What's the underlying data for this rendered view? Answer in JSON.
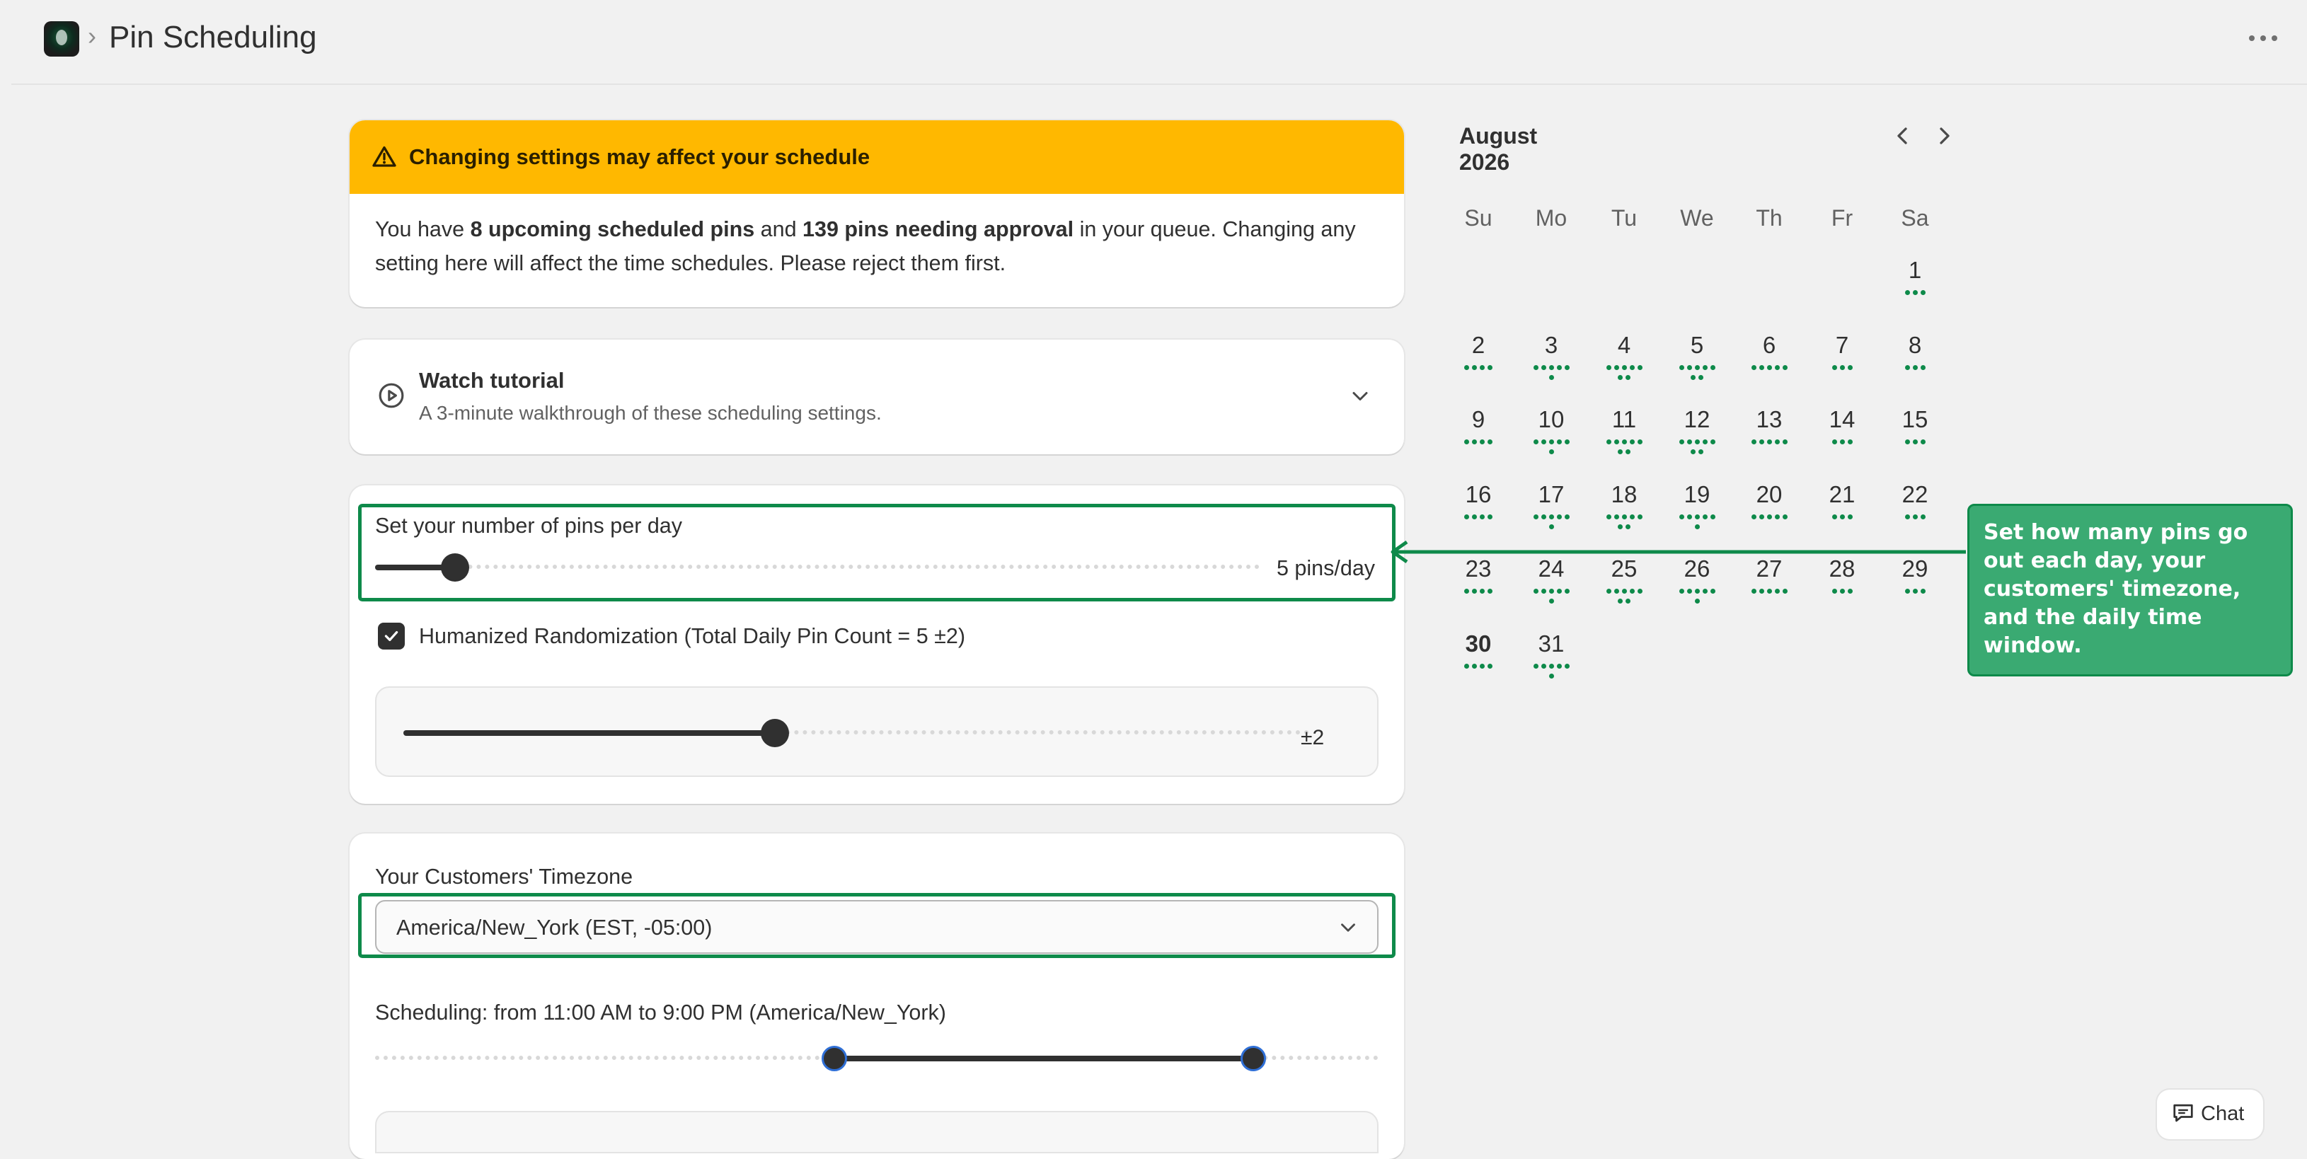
{
  "header": {
    "breadcrumb_separator": "›",
    "title": "Pin Scheduling",
    "more_icon": "more-horizontal-icon"
  },
  "banner": {
    "icon": "warning-triangle-icon",
    "title": "Changing settings may affect your schedule",
    "body_prefix": "You have ",
    "scheduled_count": "8 upcoming scheduled pins",
    "body_mid": " and ",
    "approval_count": "139 pins needing approval",
    "body_suffix": " in your queue. Changing any setting here will affect the time schedules. Please reject them first.",
    "color": "#ffb800"
  },
  "tutorial": {
    "icon": "play-circle-icon",
    "title": "Watch tutorial",
    "subtitle": "A 3-minute walkthrough of these scheduling settings.",
    "expanded": false
  },
  "pins_per_day": {
    "label": "Set your number of pins per day",
    "value_label": "5 pins/day",
    "value": 5,
    "slider_fraction": 0.09
  },
  "randomization": {
    "checked": true,
    "label": "Humanized Randomization (Total Daily Pin Count = 5 ±2)",
    "value_label": "±2",
    "slider_fraction": 0.41
  },
  "timezone": {
    "label": "Your Customers' Timezone",
    "selected": "America/New_York (EST, -05:00)"
  },
  "schedule_window": {
    "label": "Scheduling: from 11:00 AM to 9:00 PM (America/New_York)",
    "start_fraction": 0.458,
    "end_fraction": 0.875
  },
  "calendar": {
    "month_label": "August 2026",
    "prev_icon": "chevron-left-icon",
    "next_icon": "chevron-right-icon",
    "weekdays": [
      "Su",
      "Mo",
      "Tu",
      "We",
      "Th",
      "Fr",
      "Sa"
    ],
    "first_weekday_index": 6,
    "days": [
      {
        "n": "1",
        "dots": [
          3
        ]
      },
      {
        "n": "2",
        "dots": [
          4
        ]
      },
      {
        "n": "3",
        "dots": [
          5,
          1
        ]
      },
      {
        "n": "4",
        "dots": [
          5,
          2
        ]
      },
      {
        "n": "5",
        "dots": [
          5,
          2
        ]
      },
      {
        "n": "6",
        "dots": [
          5
        ]
      },
      {
        "n": "7",
        "dots": [
          3
        ]
      },
      {
        "n": "8",
        "dots": [
          3
        ]
      },
      {
        "n": "9",
        "dots": [
          4
        ]
      },
      {
        "n": "10",
        "dots": [
          5,
          1
        ]
      },
      {
        "n": "11",
        "dots": [
          5,
          2
        ]
      },
      {
        "n": "12",
        "dots": [
          5,
          2
        ]
      },
      {
        "n": "13",
        "dots": [
          5
        ]
      },
      {
        "n": "14",
        "dots": [
          3
        ]
      },
      {
        "n": "15",
        "dots": [
          3
        ]
      },
      {
        "n": "16",
        "dots": [
          4
        ]
      },
      {
        "n": "17",
        "dots": [
          5,
          1
        ]
      },
      {
        "n": "18",
        "dots": [
          5,
          2
        ]
      },
      {
        "n": "19",
        "dots": [
          5,
          1
        ]
      },
      {
        "n": "20",
        "dots": [
          5
        ]
      },
      {
        "n": "21",
        "dots": [
          3
        ]
      },
      {
        "n": "22",
        "dots": [
          3
        ]
      },
      {
        "n": "23",
        "dots": [
          4
        ]
      },
      {
        "n": "24",
        "dots": [
          5,
          1
        ]
      },
      {
        "n": "25",
        "dots": [
          5,
          2
        ]
      },
      {
        "n": "26",
        "dots": [
          5,
          1
        ]
      },
      {
        "n": "27",
        "dots": [
          5
        ]
      },
      {
        "n": "28",
        "dots": [
          3
        ]
      },
      {
        "n": "29",
        "dots": [
          3
        ]
      },
      {
        "n": "30",
        "dots": [
          4
        ],
        "today": true
      },
      {
        "n": "31",
        "dots": [
          5,
          1
        ]
      }
    ],
    "dot_color": "#0e8a4a"
  },
  "annotation": {
    "text": "Set how many pins go out each day, your customers' timezone, and the daily time window.",
    "color": "#3aaa72",
    "border_color": "#0e8a4a"
  },
  "chat": {
    "icon": "chat-bubble-icon",
    "label": "Chat"
  }
}
